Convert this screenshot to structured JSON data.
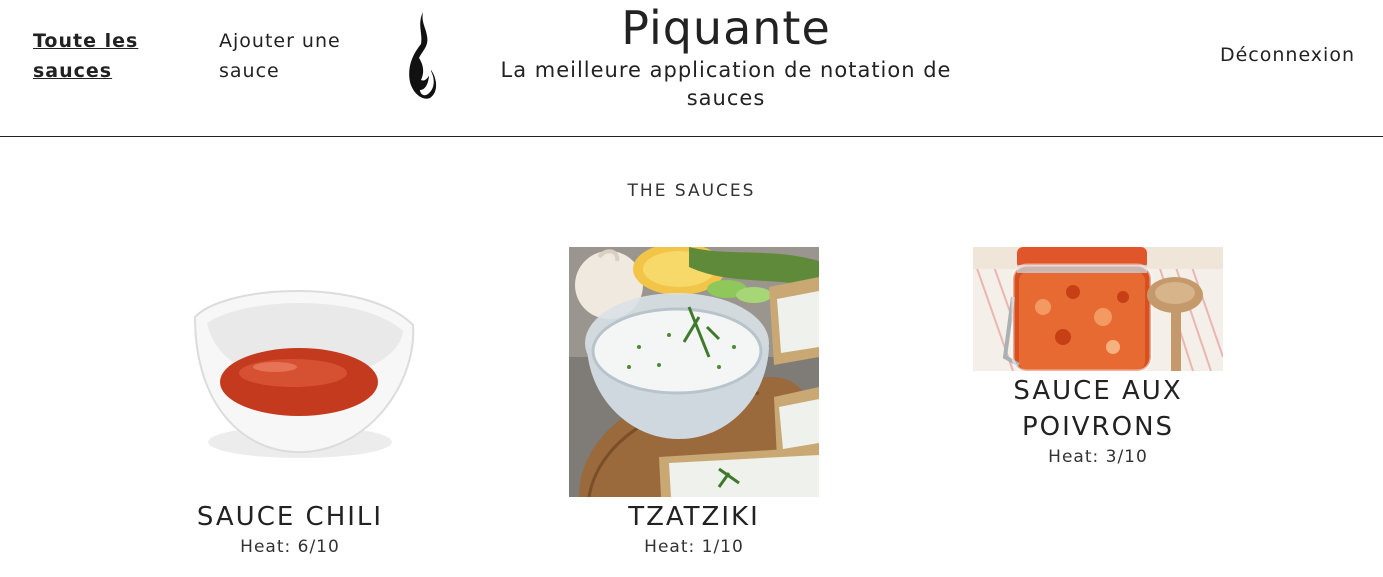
{
  "nav": {
    "all_sauces": "Toute les sauces",
    "add_sauce": "Ajouter une sauce",
    "logout": "Déconnexion"
  },
  "brand": {
    "logo_icon": "flame-icon",
    "title": "Piquante",
    "subtitle": "La meilleure application de notation de sauces"
  },
  "main": {
    "section_title": "THE SAUCES",
    "sauces": [
      {
        "name": "SAUCE CHILI",
        "heat": "Heat: 6/10",
        "image": "red-sauce-in-white-bowl"
      },
      {
        "name": "TZATZIKI",
        "heat": "Heat: 1/10",
        "image": "tzatziki-bowl-with-bread"
      },
      {
        "name": "SAUCE AUX POIVRONS",
        "heat": "Heat: 3/10",
        "image": "pepper-sauce-in-jar"
      }
    ]
  },
  "colors": {
    "text": "#222222",
    "background": "#ffffff",
    "divider": "#222222"
  }
}
